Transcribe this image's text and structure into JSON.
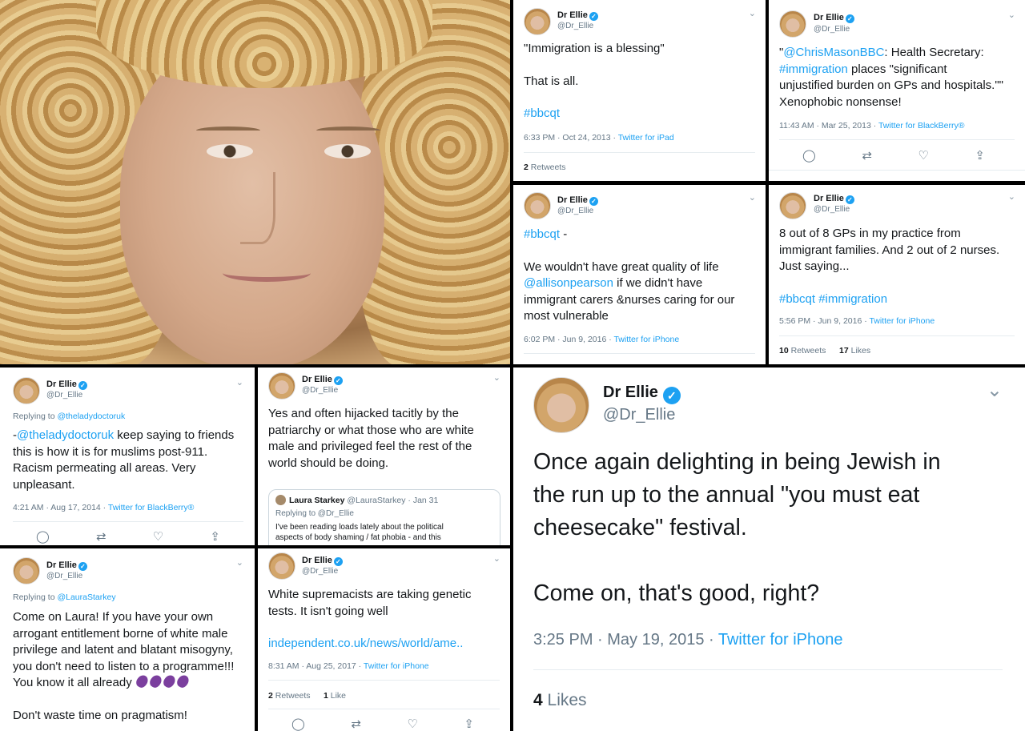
{
  "colors": {
    "link": "#1da1f2",
    "text": "#14171a",
    "muted": "#657786",
    "verified": "#1da1f2"
  },
  "icons": {
    "verified": "verified-badge-icon",
    "chevron": "chevron-down-icon",
    "reply": "reply-icon",
    "retweet": "retweet-icon",
    "like": "heart-icon",
    "share": "share-icon",
    "eggplant": "eggplant-emoji"
  },
  "author": {
    "name": "Dr Ellie",
    "handle": "@Dr_Ellie"
  },
  "t1": {
    "l1": "\"Immigration is a blessing\"",
    "l2": "That is all.",
    "tag": "#bbcqt",
    "time": "6:33 PM · Oct 24, 2013 · ",
    "source": "Twitter for iPad",
    "rt_count": "2",
    "rt_label": " Retweets"
  },
  "t2": {
    "q": "\"",
    "mention": "@ChrisMasonBBC",
    "a": ": Health Secretary:",
    "tag": "#immigration",
    "b": " places \"significant",
    "c": "unjustified burden on GPs and hospitals.\"\"",
    "d": "Xenophobic nonsense!",
    "time": "11:43 AM · Mar 25, 2013 · ",
    "source": "Twitter for BlackBerry®"
  },
  "t3": {
    "tag": "#bbcqt",
    "dash": " -",
    "l1": "We wouldn't have great quality of life",
    "mention": "@allisonpearson",
    "l2": " if we didn't have",
    "l3": "immigrant carers &nurses caring for our",
    "l4": "most vulnerable",
    "time": "6:02 PM · Jun 9, 2016 · ",
    "source": "Twitter for iPhone"
  },
  "t4": {
    "l1": "8 out of 8 GPs in my practice from",
    "l2": "immigrant families.  And 2 out of 2 nurses.",
    "l3": "Just saying...",
    "tags": "#bbcqt #immigration",
    "time": "5:56 PM · Jun 9, 2016 · ",
    "source": "Twitter for iPhone",
    "rt_count": "10",
    "rt_label": " Retweets",
    "like_count": "17",
    "like_label": " Likes"
  },
  "t5": {
    "reply_label": "Replying to ",
    "reply_to": "@theladydoctoruk",
    "dash": "-",
    "mention": "@theladydoctoruk",
    "l1": " keep saying to friends",
    "l2": "this is how it is for muslims post-911.",
    "l3": "Racism permeating all areas. Very",
    "l4": "unpleasant.",
    "time": "4:21 AM · Aug 17, 2014 · ",
    "source": "Twitter for BlackBerry®"
  },
  "t6": {
    "l1": "Yes and often hijacked tacitly by the",
    "l2": "patriarchy or what those who are white",
    "l3": "male and privileged feel the rest of the",
    "l4": "world should be doing.",
    "quote": {
      "name": "Laura Starkey",
      "handle": " @LauraStarkey · Jan 31",
      "reply": "Replying to @Dr_Ellie",
      "l1": "I've been reading loads lately about the political",
      "l2": "aspects of body shaming / fat phobia - and this"
    }
  },
  "t7": {
    "reply_label": "Replying to ",
    "reply_to": "@LauraStarkey",
    "l1": "Come on Laura!   If you have your own",
    "l2": "arrogant entitlement borne of white male",
    "l3": "privilege and latent and blatant misogyny,",
    "l4": "you don't need to listen to a programme!!!",
    "l5": "You know it all already",
    "l6": "Don't waste time on pragmatism!"
  },
  "t8": {
    "l1": "White supremacists are taking genetic",
    "l2": "tests. It isn't going well",
    "link": "independent.co.uk/news/world/ame..",
    "time": "8:31 AM · Aug 25, 2017 · ",
    "source": "Twitter for iPhone",
    "rt_count": "2",
    "rt_label": " Retweets",
    "like_count": "1",
    "like_label": " Like"
  },
  "t9": {
    "l1": "Once again delighting in being Jewish in",
    "l2": "the run up to the annual \"you must eat",
    "l3": "cheesecake\" festival.",
    "l4": "Come on, that's good, right?",
    "time": "3:25 PM · May 19, 2015 · ",
    "source": "Twitter for iPhone",
    "like_count": "4",
    "like_label": " Likes"
  }
}
